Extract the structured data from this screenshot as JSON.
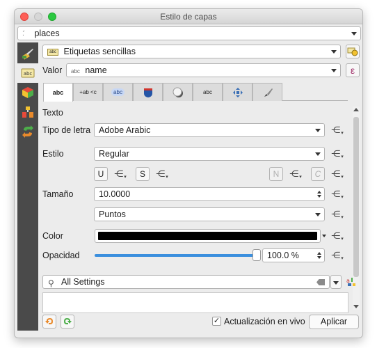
{
  "window": {
    "title": "Estilo de capas"
  },
  "layer": {
    "selected": "places"
  },
  "renderer": {
    "selected": "Etiquetas sencillas",
    "badge": "abc"
  },
  "value": {
    "label": "Valor",
    "prefix": "abc",
    "field": "name",
    "expr_symbol": "ε"
  },
  "tabs": [
    {
      "name": "tab-text",
      "label": "abc"
    },
    {
      "name": "tab-formatting",
      "label": "+ab <c"
    },
    {
      "name": "tab-buffer",
      "label": "abc"
    },
    {
      "name": "tab-background",
      "label": ""
    },
    {
      "name": "tab-shadow",
      "label": ""
    },
    {
      "name": "tab-callouts",
      "label": "abc"
    },
    {
      "name": "tab-placement",
      "label": ""
    },
    {
      "name": "tab-rendering",
      "label": ""
    }
  ],
  "text_panel": {
    "section": "Texto",
    "font_label": "Tipo de letra",
    "font_value": "Adobe Arabic",
    "style_label": "Estilo",
    "style_value": "Regular",
    "underline": "U",
    "strike": "S",
    "bold": "N",
    "italic": "C",
    "size_label": "Tamaño",
    "size_value": "10.0000",
    "unit_value": "Puntos",
    "color_label": "Color",
    "opacity_label": "Opacidad",
    "opacity_value": "100.0 %",
    "opacity_fraction": 1.0
  },
  "search": {
    "value": "All Settings"
  },
  "footer": {
    "live_update_label": "Actualización en vivo",
    "live_update_checked": true,
    "check_mark": "✓",
    "apply_label": "Aplicar"
  },
  "colors": {
    "accent": "#3b8fde",
    "text_color": "#000000"
  }
}
